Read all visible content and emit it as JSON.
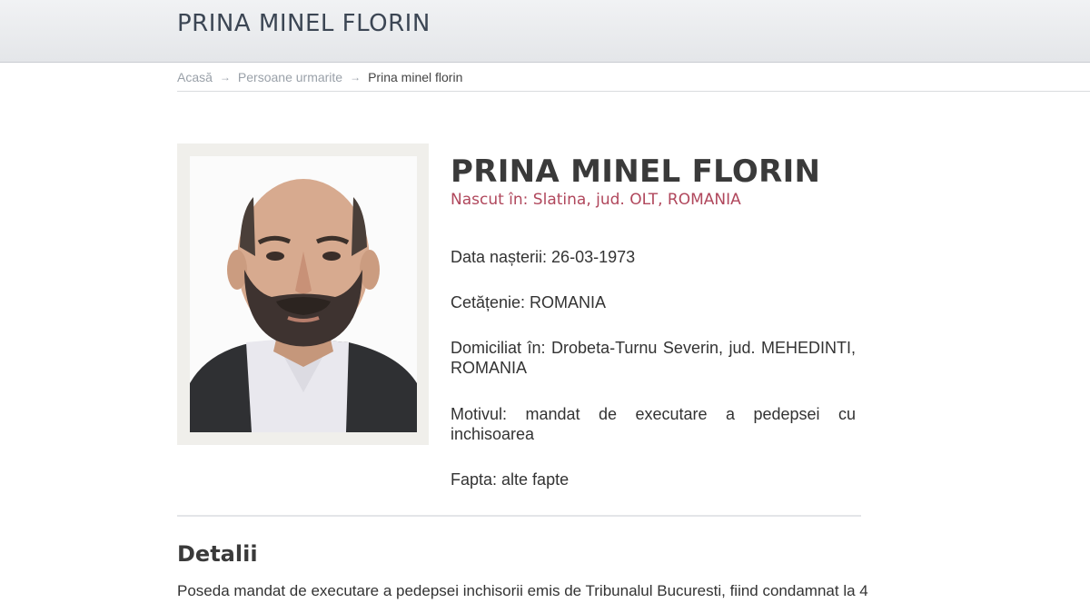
{
  "header": {
    "title": "PRINA MINEL FLORIN"
  },
  "breadcrumb": {
    "home": "Acasă",
    "section": "Persoane urmarite",
    "current": "Prina minel florin",
    "separator": "→"
  },
  "person": {
    "name": "PRINA MINEL FLORIN",
    "born": "Nascut în: Slatina, jud. OLT, ROMANIA",
    "birth_date": "Data nașterii: 26-03-1973",
    "citizenship": "Cetățenie: ROMANIA",
    "domicile": "Domiciliat în: Drobeta-Turnu Severin, jud. MEHEDINTI, ROMANIA",
    "reason": "Motivul: mandat de executare a pedepsei cu inchisoarea",
    "deed": "Fapta: alte fapte"
  },
  "details": {
    "title": "Detalii",
    "text": "Poseda mandat de executare a pedepsei inchisorii emis de Tribunalul Bucuresti, fiind condamnat la 4"
  },
  "colors": {
    "accent": "#b0475c",
    "header_bg": "#e6e8eb"
  }
}
